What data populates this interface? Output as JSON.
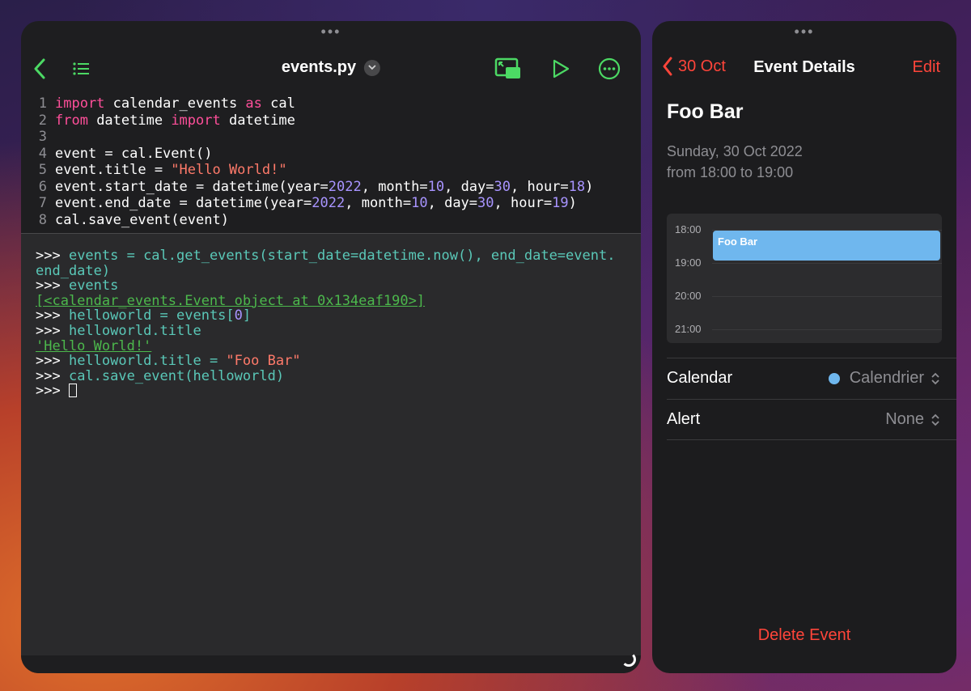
{
  "editor": {
    "file_name": "events.py",
    "code": [
      {
        "n": "1",
        "parts": [
          {
            "t": "import",
            "c": "kw"
          },
          {
            "t": " calendar_events ",
            "c": ""
          },
          {
            "t": "as",
            "c": "kw"
          },
          {
            "t": " cal",
            "c": ""
          }
        ]
      },
      {
        "n": "2",
        "parts": [
          {
            "t": "from",
            "c": "kw"
          },
          {
            "t": " datetime ",
            "c": ""
          },
          {
            "t": "import",
            "c": "kw"
          },
          {
            "t": " datetime",
            "c": ""
          }
        ]
      },
      {
        "n": "3",
        "parts": []
      },
      {
        "n": "4",
        "parts": [
          {
            "t": "event = cal.Event()",
            "c": ""
          }
        ]
      },
      {
        "n": "5",
        "parts": [
          {
            "t": "event.title = ",
            "c": ""
          },
          {
            "t": "\"Hello World!\"",
            "c": "str"
          }
        ]
      },
      {
        "n": "6",
        "parts": [
          {
            "t": "event.start_date = datetime(year=",
            "c": ""
          },
          {
            "t": "2022",
            "c": "num"
          },
          {
            "t": ", month=",
            "c": ""
          },
          {
            "t": "10",
            "c": "num"
          },
          {
            "t": ", day=",
            "c": ""
          },
          {
            "t": "30",
            "c": "num"
          },
          {
            "t": ", hour=",
            "c": ""
          },
          {
            "t": "18",
            "c": "num"
          },
          {
            "t": ")",
            "c": ""
          }
        ]
      },
      {
        "n": "7",
        "parts": [
          {
            "t": "event.end_date = datetime(year=",
            "c": ""
          },
          {
            "t": "2022",
            "c": "num"
          },
          {
            "t": ", month=",
            "c": ""
          },
          {
            "t": "10",
            "c": "num"
          },
          {
            "t": ", day=",
            "c": ""
          },
          {
            "t": "30",
            "c": "num"
          },
          {
            "t": ", hour=",
            "c": ""
          },
          {
            "t": "19",
            "c": "num"
          },
          {
            "t": ")",
            "c": ""
          }
        ]
      },
      {
        "n": "8",
        "parts": [
          {
            "t": "cal.save_event(event)",
            "c": ""
          }
        ]
      }
    ],
    "console": [
      [
        {
          "t": ">>> ",
          "c": "prompt"
        },
        {
          "t": "events = cal.get_events(start_date=datetime.now(), end_date=event.",
          "c": "py"
        }
      ],
      [
        {
          "t": "end_date)",
          "c": "py"
        }
      ],
      [
        {
          "t": ">>> ",
          "c": "prompt"
        },
        {
          "t": "events",
          "c": "py"
        }
      ],
      [
        {
          "t": "[<calendar_events.Event object at 0x134eaf190>]",
          "c": "out"
        }
      ],
      [
        {
          "t": ">>> ",
          "c": "prompt"
        },
        {
          "t": "helloworld = events[",
          "c": "py"
        },
        {
          "t": "0",
          "c": "num"
        },
        {
          "t": "]",
          "c": "py"
        }
      ],
      [
        {
          "t": ">>> ",
          "c": "prompt"
        },
        {
          "t": "helloworld.title",
          "c": "py"
        }
      ],
      [
        {
          "t": "'Hello World!'",
          "c": "out"
        }
      ],
      [
        {
          "t": ">>> ",
          "c": "prompt"
        },
        {
          "t": "helloworld.title = ",
          "c": "py"
        },
        {
          "t": "\"Foo Bar\"",
          "c": "str"
        }
      ],
      [
        {
          "t": ">>> ",
          "c": "prompt"
        },
        {
          "t": "cal.save_event(helloworld)",
          "c": "py"
        }
      ],
      [
        {
          "t": ">>> ",
          "c": "prompt"
        }
      ]
    ]
  },
  "calendar": {
    "back_label": "30 Oct",
    "nav_title": "Event Details",
    "edit_label": "Edit",
    "event_title": "Foo Bar",
    "date_line": "Sunday, 30 Oct 2022",
    "time_line": "from 18:00 to 19:00",
    "timeline": {
      "hours": [
        "18:00",
        "19:00",
        "20:00",
        "21:00"
      ],
      "event_label": "Foo Bar"
    },
    "calendar_label": "Calendar",
    "calendar_value": "Calendrier",
    "alert_label": "Alert",
    "alert_value": "None",
    "delete_label": "Delete Event"
  },
  "colors": {
    "accent_red": "#ff453a",
    "accent_green": "#4cd964",
    "event_blue": "#6fb7ee"
  }
}
